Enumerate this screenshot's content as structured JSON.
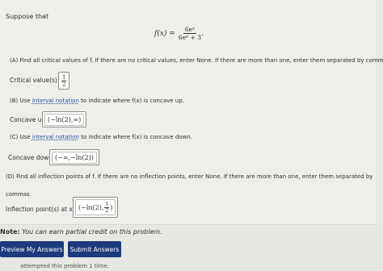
{
  "intro": "Suppose that",
  "formula": {
    "lhs": "f(x) =",
    "numerator": "6eˣ",
    "denominator": "6eˣ + 3",
    "trail": "."
  },
  "part_a": {
    "question": "(A) Find all critical values of f. If there are no critical values, enter None. If there are more than one, enter them separated by commas.",
    "label": "Critical value(s) =",
    "answer_num": "1",
    "answer_den": "2"
  },
  "part_b": {
    "question_prefix": "(B) Use",
    "link_text": "interval notation",
    "question_suffix": "to indicate where f(x) is concave up.",
    "label": "Concave up:",
    "answer": "(−ln(2),∞)"
  },
  "part_c": {
    "question_prefix": "(C) Use",
    "link_text": "interval notation",
    "question_suffix": "to indicate where f(x) is concave down.",
    "label": "Concave down:",
    "answer": "(−∞,−ln(2))"
  },
  "part_d": {
    "question_line1": "(D) Find all inflection points of f. If there are no inflection points, enter None. If there are more than one, enter them separated by",
    "question_line2": "commas.",
    "label": "Inflection point(s) at x =",
    "answer_prefix": "(−ln(2),",
    "answer_num": "1",
    "answer_den": "2",
    "answer_suffix": ")"
  },
  "note_label": "Note:",
  "note_text": "You can earn partial credit on this problem.",
  "buttons": {
    "preview": "Preview My Answers",
    "submit": "Submit Answers"
  },
  "attempt_text": "attempted this problem 1 time."
}
